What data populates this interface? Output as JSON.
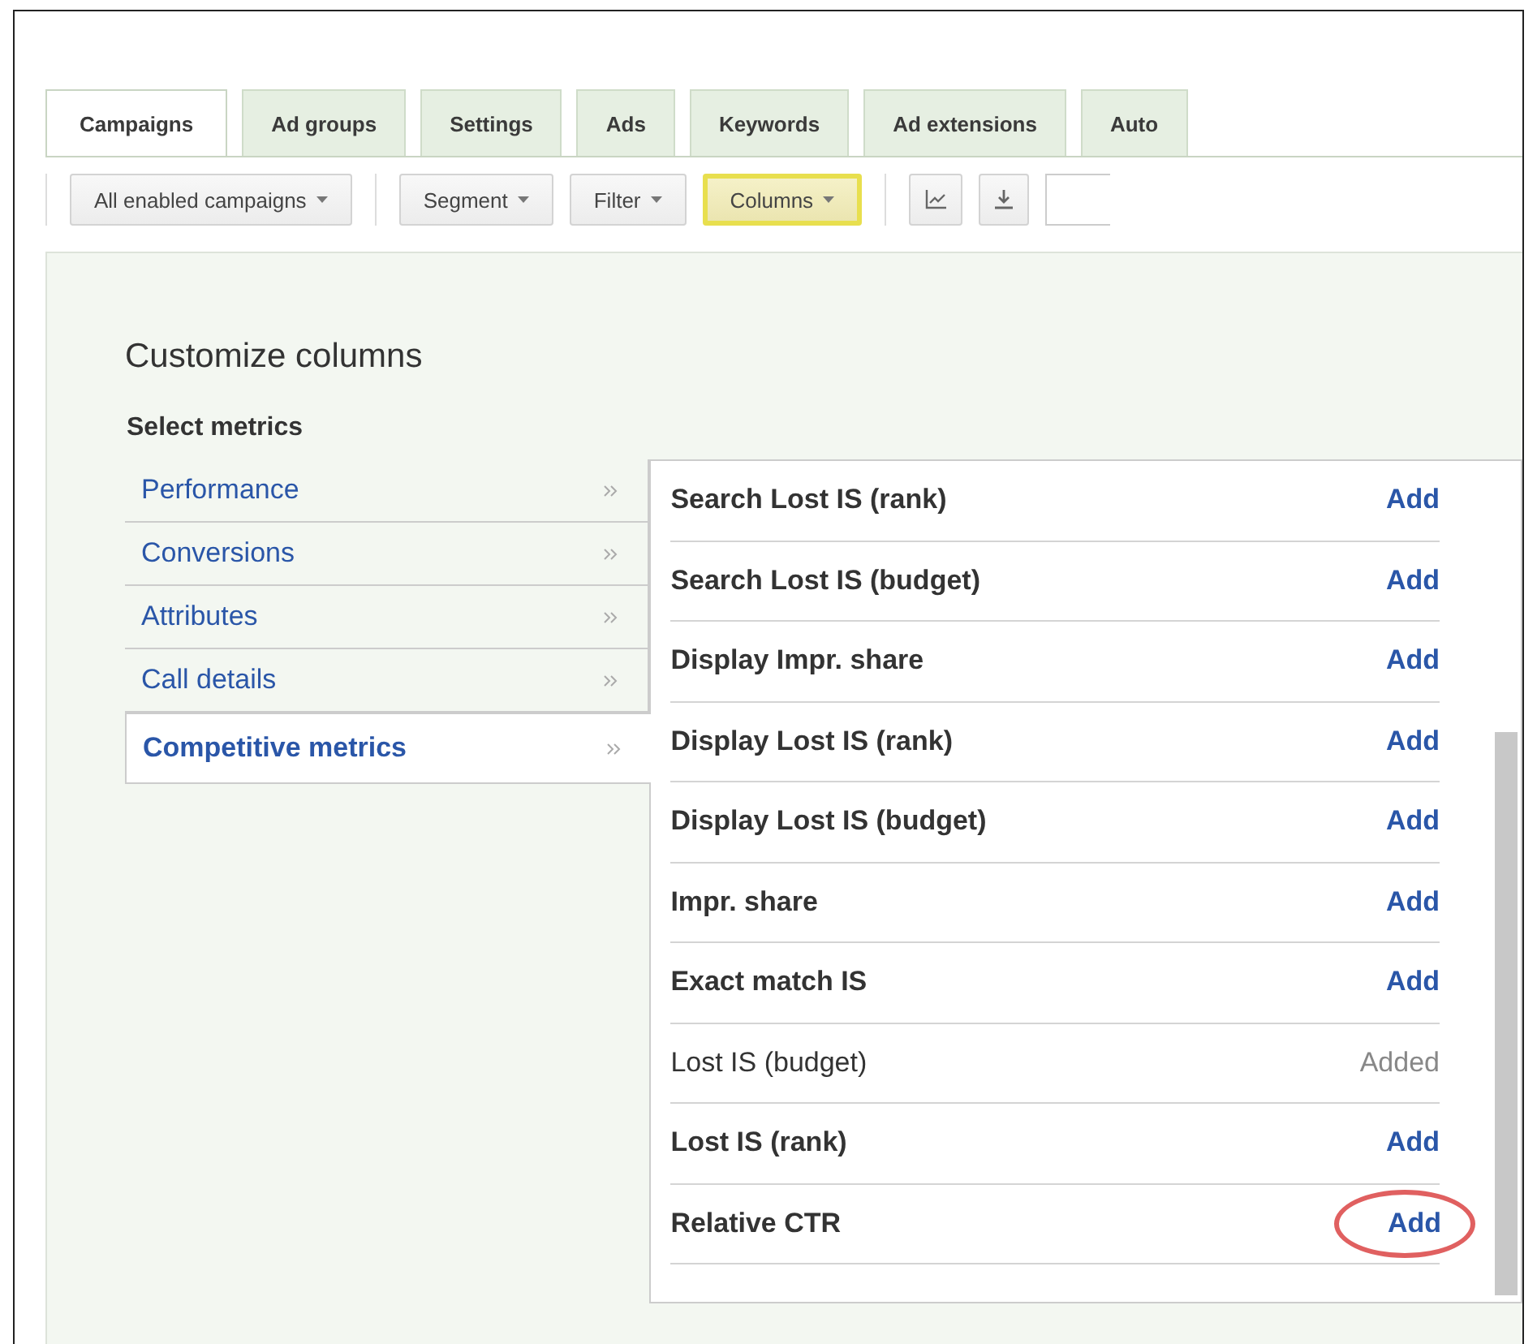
{
  "tabs": [
    {
      "label": "Campaigns",
      "selected": true
    },
    {
      "label": "Ad groups",
      "selected": false
    },
    {
      "label": "Settings",
      "selected": false
    },
    {
      "label": "Ads",
      "selected": false
    },
    {
      "label": "Keywords",
      "selected": false
    },
    {
      "label": "Ad extensions",
      "selected": false
    },
    {
      "label": "Auto",
      "selected": false
    }
  ],
  "toolbar": {
    "groups": [
      [
        {
          "kind": "dropdown",
          "label": "All enabled campaigns",
          "highlighted": false
        }
      ],
      [
        {
          "kind": "dropdown",
          "label": "Segment",
          "highlighted": false
        },
        {
          "kind": "dropdown",
          "label": "Filter",
          "highlighted": false
        },
        {
          "kind": "dropdown",
          "label": "Columns",
          "highlighted": true
        }
      ],
      [
        {
          "kind": "chart",
          "highlighted": false
        },
        {
          "kind": "download",
          "highlighted": false
        },
        {
          "kind": "field"
        }
      ]
    ]
  },
  "panel": {
    "title": "Customize columns",
    "subtitle": "Select metrics",
    "categories": [
      {
        "label": "Performance",
        "selected": false
      },
      {
        "label": "Conversions",
        "selected": false
      },
      {
        "label": "Attributes",
        "selected": false
      },
      {
        "label": "Call details",
        "selected": false
      },
      {
        "label": "Competitive metrics",
        "selected": true
      }
    ],
    "metrics": [
      {
        "name": "Search Lost IS (rank)",
        "action": "Add",
        "added": false,
        "highlighted": false
      },
      {
        "name": "Search Lost IS (budget)",
        "action": "Add",
        "added": false,
        "highlighted": false
      },
      {
        "name": "Display Impr. share",
        "action": "Add",
        "added": false,
        "highlighted": false
      },
      {
        "name": "Display Lost IS (rank)",
        "action": "Add",
        "added": false,
        "highlighted": false
      },
      {
        "name": "Display Lost IS (budget)",
        "action": "Add",
        "added": false,
        "highlighted": false
      },
      {
        "name": "Impr. share",
        "action": "Add",
        "added": false,
        "highlighted": false
      },
      {
        "name": "Exact match IS",
        "action": "Add",
        "added": false,
        "highlighted": false
      },
      {
        "name": "Lost IS (budget)",
        "action": "Added",
        "added": true,
        "highlighted": false
      },
      {
        "name": "Lost IS (rank)",
        "action": "Add",
        "added": false,
        "highlighted": false
      },
      {
        "name": "Relative CTR",
        "action": "Add",
        "added": false,
        "highlighted": true
      }
    ]
  }
}
